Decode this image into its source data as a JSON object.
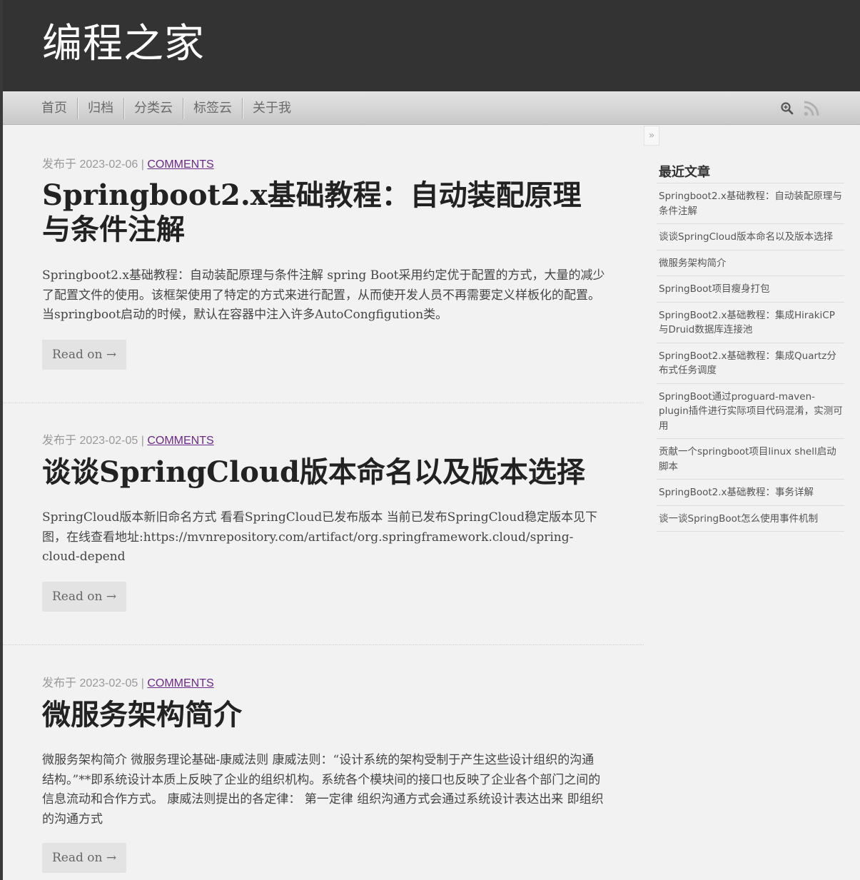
{
  "site": {
    "title": "编程之家"
  },
  "nav": {
    "items": [
      {
        "label": "首页"
      },
      {
        "label": "归档"
      },
      {
        "label": "分类云"
      },
      {
        "label": "标签云"
      },
      {
        "label": "关于我"
      }
    ],
    "icons": [
      "search-icon",
      "rss-icon"
    ]
  },
  "posts": [
    {
      "date": "发布于 2023-02-06",
      "comments": "COMMENTS",
      "title": "Springboot2.x基础教程：自动装配原理与条件注解",
      "excerpt": "Springboot2.x基础教程：自动装配原理与条件注解 spring Boot采用约定优于配置的方式，大量的减少了配置文件的使用。该框架使用了特定的方式来进行配置，从而使开发人员不再需要定义样板化的配置。 当springboot启动的时候，默认在容器中注入许多AutoCongfigution类。",
      "read_label": "Read on →"
    },
    {
      "date": "发布于 2023-02-05",
      "comments": "COMMENTS",
      "title": " 谈谈SpringCloud版本命名以及版本选择",
      "excerpt": "SpringCloud版本新旧命名方式 看看SpringCloud已发布版本 当前已发布SpringCloud稳定版本见下图，在线查看地址:https://mvnrepository.com/artifact/org.springframework.cloud/spring-cloud-depend",
      "read_label": "Read on →"
    },
    {
      "date": "发布于 2023-02-05",
      "comments": "COMMENTS",
      "title": "微服务架构简介",
      "excerpt": "微服务架构简介 微服务理论基础-康威法则 康威法则：“设计系统的架构受制于产生这些设计组织的沟通结构。”**即系统设计本质上反映了企业的组织机构。系统各个模块间的接口也反映了企业各个部门之间的信息流动和合作方式。 康威法则提出的各定律： 第一定律 组织沟通方式会通过系统设计表达出来 即组织的沟通方式",
      "read_label": "Read on →"
    }
  ],
  "sidebar": {
    "toggle": "»",
    "widget_title": "最近文章",
    "recent": [
      "Springboot2.x基础教程：自动装配原理与条件注解",
      " 谈谈SpringCloud版本命名以及版本选择",
      "微服务架构简介",
      "SpringBoot项目瘦身打包",
      "SpringBoot2.x基础教程：集成HirakiCP与Druid数据库连接池",
      "SpringBoot2.x基础教程：集成Quartz分布式任务调度",
      "SpringBoot通过proguard-maven-plugin插件进行实际项目代码混淆，实测可用",
      "贡献一个springboot项目linux shell启动脚本",
      "SpringBoot2.x基础教程：事务详解",
      "谈一谈SpringBoot怎么使用事件机制"
    ]
  }
}
